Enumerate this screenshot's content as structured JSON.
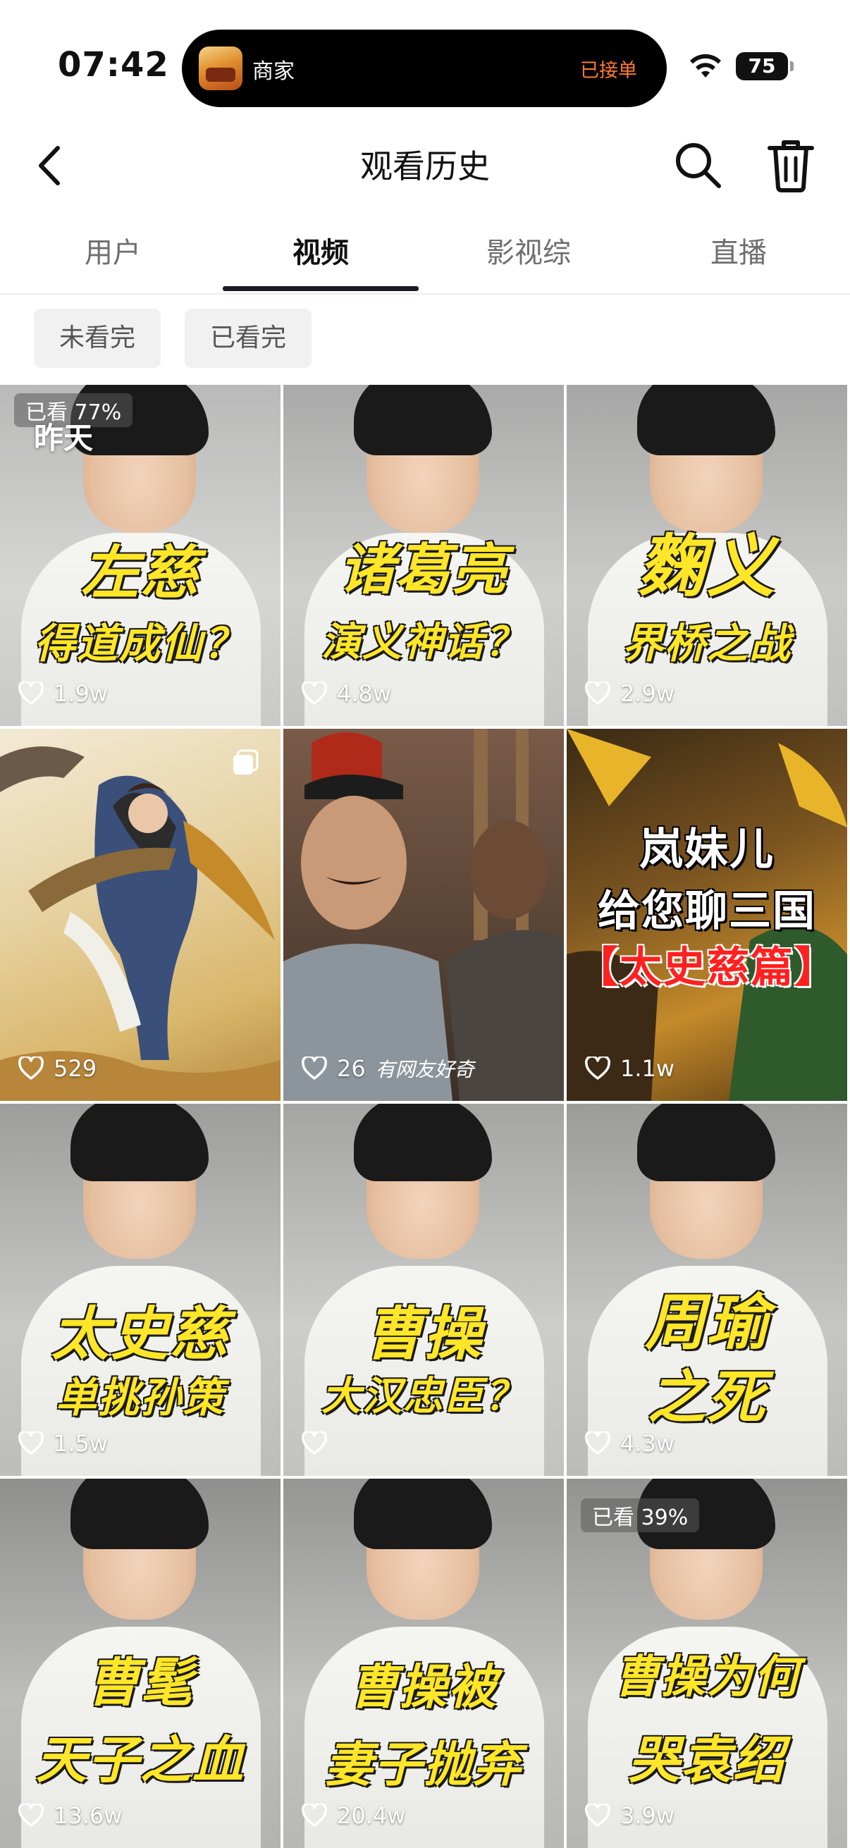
{
  "status_bar": {
    "time": "07:42",
    "live_activity_app": "商家",
    "live_activity_status": "已接单",
    "battery": "75"
  },
  "header": {
    "title": "观看历史",
    "icons": [
      "chevron-left-icon",
      "search-icon",
      "trash-icon"
    ]
  },
  "tabs": [
    {
      "label": "用户",
      "active": false
    },
    {
      "label": "视频",
      "active": true
    },
    {
      "label": "影视综",
      "active": false
    },
    {
      "label": "直播",
      "active": false
    }
  ],
  "filters": [
    {
      "label": "未看完"
    },
    {
      "label": "已看完"
    }
  ],
  "date_label": "昨天",
  "videos": [
    {
      "watched": "已看 77%",
      "line1": "左慈",
      "line2": "得道成仙？",
      "likes": "1.9w"
    },
    {
      "line1": "诸葛亮",
      "line2": "演义神话？",
      "likes": "4.8w"
    },
    {
      "line1": "麴义",
      "line2": "界桥之战",
      "likes": "2.9w"
    },
    {
      "likes": "529"
    },
    {
      "likes": "26",
      "caption": "有网友好奇"
    },
    {
      "line1": "岚妹儿",
      "line2": "给您聊三国",
      "line3": "【太史慈篇】",
      "likes": "1.1w"
    },
    {
      "line1": "太史慈",
      "line2": "单挑孙策",
      "likes": "1.5w"
    },
    {
      "line1": "曹操",
      "line2": "大汉忠臣？",
      "likes": ""
    },
    {
      "line1": "周瑜",
      "line2": "之死",
      "likes": "4.3w"
    },
    {
      "line1": "曹髦",
      "line2": "天子之血",
      "likes": "13.6w"
    },
    {
      "line1": "曹操被",
      "line2": "妻子抛弃",
      "likes": "20.4w"
    },
    {
      "watched": "已看 39%",
      "line1": "曹操为何",
      "line2": "哭袁绍",
      "likes": "3.9w"
    }
  ],
  "colors": {
    "headline_yellow": "#ffe628",
    "accent_orange": "#ff7a2e",
    "tab_indicator": "#1b1b24"
  }
}
